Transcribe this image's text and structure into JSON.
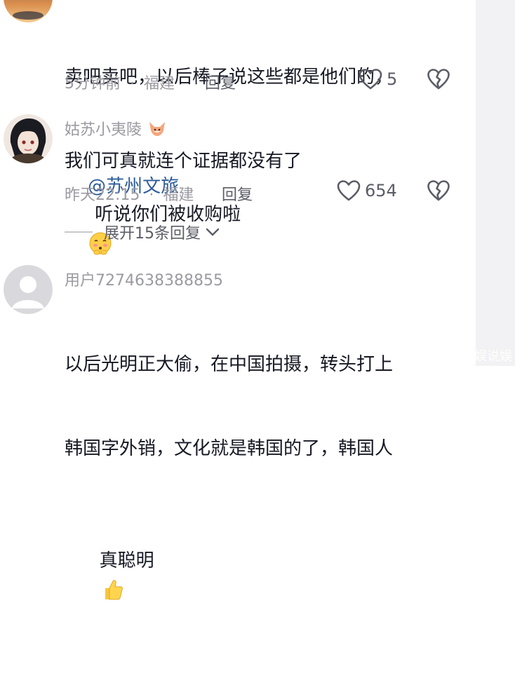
{
  "comments": [
    {
      "username": "",
      "body_lines": [
        "卖吧卖吧，以后棒子说这些都是他们的，",
        "我们可真就连个证据都没有了"
      ],
      "time": "5分钟前",
      "location": "福建",
      "separator": "·",
      "reply_label": "回复",
      "likes": "5"
    },
    {
      "username": "姑苏小夷陵",
      "mention": "@苏州文旅",
      "body_text": "听说你们被收购啦",
      "time": "昨天22:15",
      "location": "福建",
      "separator": "·",
      "reply_label": "回复",
      "likes": "654",
      "expand_label": "展开15条回复"
    },
    {
      "username": "用户7274638388855",
      "body_lines": [
        "以后光明正大偷，在中国拍摄，转头打上",
        "韩国字外销，文化就是韩国的了，韩国人",
        "真聪明"
      ],
      "time": "",
      "likes": ""
    }
  ],
  "icons": {
    "like": "heart-outline-icon",
    "dislike": "broken-heart-icon",
    "expand": "chevron-down-icon"
  },
  "colors": {
    "mention": "#2d5b9a",
    "meta_text": "#9a9aa1",
    "body_text": "#161823"
  },
  "watermark": "娱说娱"
}
